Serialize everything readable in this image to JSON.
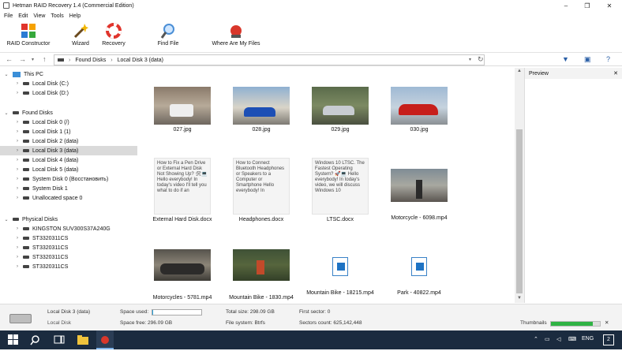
{
  "window": {
    "title": "Hetman RAID Recovery 1.4 (Commercial Edition)"
  },
  "menu": [
    "File",
    "Edit",
    "View",
    "Tools",
    "Help"
  ],
  "toolbar": {
    "raid_constructor": "RAID Constructor",
    "wizard": "Wizard",
    "recovery": "Recovery",
    "find_file": "Find File",
    "where_are_my_files": "Where Are My Files"
  },
  "address": {
    "segments": [
      "Found Disks",
      "Local Disk 3 (data)"
    ]
  },
  "tree": {
    "this_pc": "This PC",
    "this_pc_items": [
      "Local Disk (C:)",
      "Local Disk (D:)"
    ],
    "found_disks": "Found Disks",
    "found_disks_items": [
      "Local Disk 0 (/)",
      "Local Disk 1 (1)",
      "Local Disk 2 (data)",
      "Local Disk 3 (data)",
      "Local Disk 4 (data)",
      "Local Disk 5 (data)",
      "System Disk 0 (Восстановить)",
      "System Disk 1",
      "Unallocated space 0"
    ],
    "physical_disks": "Physical Disks",
    "physical_disks_items": [
      "KINGSTON SUV300S37A240G",
      "ST3320311CS",
      "ST3320311CS",
      "ST3320311CS",
      "ST3320311CS"
    ]
  },
  "files": [
    {
      "name": "027.jpg"
    },
    {
      "name": "028.jpg"
    },
    {
      "name": "029.jpg"
    },
    {
      "name": "030.jpg"
    },
    {
      "name": "External Hard Disk.docx",
      "text": "How to Fix a Pen Drive or External Hard Disk Not Showing Up? 🛠💻 Hello everybody! In today's video I'll tell you what to do if an"
    },
    {
      "name": "Headphones.docx",
      "text": "How to Connect Bluetooth Headphones or Speakers to a Computer or Smartphone Hello everybody! In"
    },
    {
      "name": "LTSC.docx",
      "text": "Windows 10 LTSC. The Fastest Operating System? 🚀💻 Hello everybody! In today's video, we will discuss Windows 10"
    },
    {
      "name": "Motorcycle - 6098.mp4"
    },
    {
      "name": "Motorcycles - 5781.mp4"
    },
    {
      "name": "Mountain Bike - 1830.mp4"
    },
    {
      "name": "Mountain Bike - 18215.mp4"
    },
    {
      "name": "Park - 40822.mp4"
    }
  ],
  "preview": {
    "title": "Preview"
  },
  "status": {
    "disk_name": "Local Disk 3 (data)",
    "disk_type": "Local Disk",
    "space_used_label": "Space used:",
    "space_free": "Space free: 296.09 GB",
    "total_size": "Total size: 298.09 GB",
    "file_system": "File system: Btrfs",
    "first_sector": "First sector: 0",
    "sectors_count": "Sectors count: 625,142,448",
    "thumbnails": "Thumbnails",
    "space_used_fraction": 0.01,
    "thumbnails_fraction": 0.85
  },
  "taskbar": {
    "lang": "ENG",
    "notif_count": "2"
  }
}
